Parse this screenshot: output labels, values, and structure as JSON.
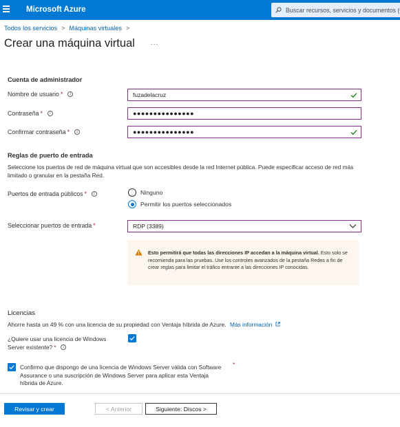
{
  "topbar": {
    "brand": "Microsoft Azure",
    "search_placeholder": "Buscar recursos, servicios y documentos (G",
    "accent": "#0078d4"
  },
  "breadcrumb": {
    "items": [
      "Todos los servicios",
      "Máquinas virtuales"
    ],
    "separator": ">"
  },
  "page": {
    "title": "Crear una máquina virtual",
    "more": "..."
  },
  "admin": {
    "heading": "Cuenta de administrador",
    "username_label": "Nombre de usuario",
    "username_value": "fuzadelacruz",
    "password_label": "Contraseña",
    "password_value": "●●●●●●●●●●●●●●●",
    "confirm_label": "Confirmar contraseña",
    "confirm_value": "●●●●●●●●●●●●●●●",
    "required_mark": "*"
  },
  "ports": {
    "heading": "Reglas de puerto de entrada",
    "description": "Seleccione los puertos de red de máquina virtual que son accesibles desde la red Internet pública. Puede especificar acceso de red más limitado o granular en la pestaña Red.",
    "public_label": "Puertos de entrada públicos",
    "option_none": "Ninguno",
    "option_allow": "Permitir los puertos seleccionados",
    "selected_option": "Permitir los puertos seleccionados",
    "select_label": "Seleccionar puertos de entrada",
    "select_value": "RDP (3389)",
    "warning_bold": "Esto permitirá que todas las direcciones IP accedan a la máquina virtual.",
    "warning_text": " Esto solo se recomienda para las pruebas.  Use los controles avanzados de la pestaña Redes a fin de crear reglas para limitar el tráfico entrante a las direcciones IP conocidas."
  },
  "licenses": {
    "heading": "Licencias",
    "savings_text": "Ahorre hasta un 49 % con una licencia de su propiedad con Ventaja híbrida de Azure.",
    "learn_more": "Más información",
    "existing_label_line1": "¿Quiere usar una licencia de Windows",
    "existing_label_line2": "Server existente?",
    "existing_checked": true,
    "confirm_text": "Confirmo que dispongo de una licencia de Windows Server válida con Software Assurance o una suscripción de Windows Server para aplicar esta Ventaja híbrida de Azure.",
    "confirm_checked": true
  },
  "footer": {
    "review_create": "Revisar y crear",
    "previous": "< Anterior",
    "next": "Siguiente: Discos >"
  }
}
